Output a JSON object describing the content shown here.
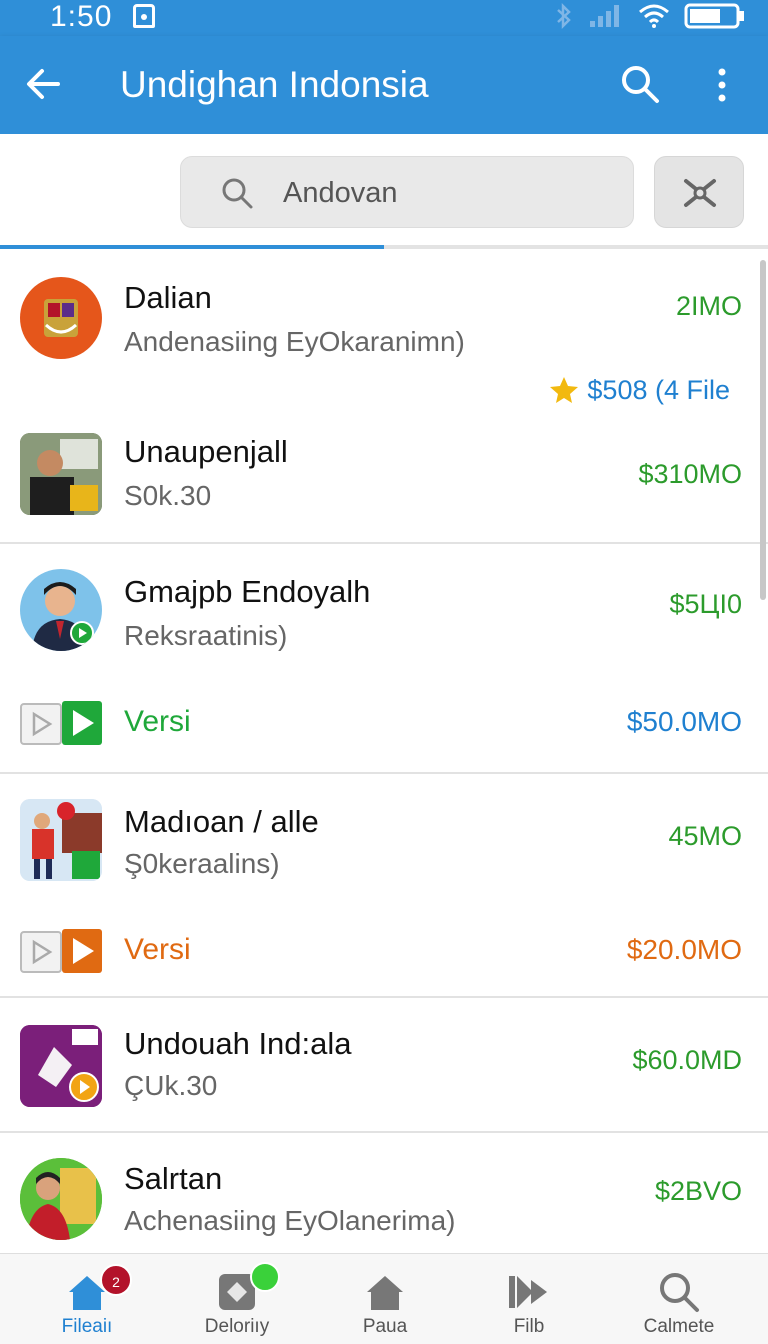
{
  "status_bar": {
    "time": "1:50",
    "icons": [
      "nfc-icon",
      "bluetooth-icon",
      "signal-icon",
      "wifi-icon",
      "battery-icon"
    ]
  },
  "app_bar": {
    "title": "Undighan Indonsia",
    "color": "#2f8fd8"
  },
  "search": {
    "value": "Andovan",
    "placeholder": "Andovan"
  },
  "progress": {
    "fraction": 0.5
  },
  "items": [
    {
      "name": "Dalian",
      "subtitle": "Andenasiing EyOkaranimn)",
      "price": "2IMO",
      "rating_text": "$508 (4 File"
    },
    {
      "name": "Unaupenjall",
      "subtitle": "S0k.30",
      "price": "$310MO"
    },
    {
      "name": "Gmajpb Endoyalh",
      "subtitle": "Reksraatinis)",
      "price": "$5ЦI0",
      "versi_label": "Versi",
      "versi_price": "$50.0MO"
    },
    {
      "name": "Madıoan / alle",
      "subtitle": "Ş0keraalins)",
      "price": "45MO",
      "versi_label": "Versi",
      "versi_price": "$20.0MO"
    },
    {
      "name": "Undouah Ind:ala",
      "subtitle": "ÇUk.30",
      "price": "$60.0MD"
    },
    {
      "name": "Salrtan",
      "subtitle": "Achenasiing EyOlanerima)",
      "price": "$2BVO"
    }
  ],
  "bottom_nav": [
    {
      "label": "Fileaiı",
      "icon": "home-icon",
      "badge": "2"
    },
    {
      "label": "Deloriıy",
      "icon": "tag-icon"
    },
    {
      "label": "Paua",
      "icon": "house-icon"
    },
    {
      "label": "Filb",
      "icon": "play-forward-icon"
    },
    {
      "label": "Calmete",
      "icon": "search-icon"
    }
  ],
  "colors": {
    "accent": "#2f8fd8",
    "price_green": "#2c9b2c",
    "versi_green": "#1fa83a",
    "versi_orange": "#e06a12",
    "rating_blue": "#1f80d0"
  }
}
